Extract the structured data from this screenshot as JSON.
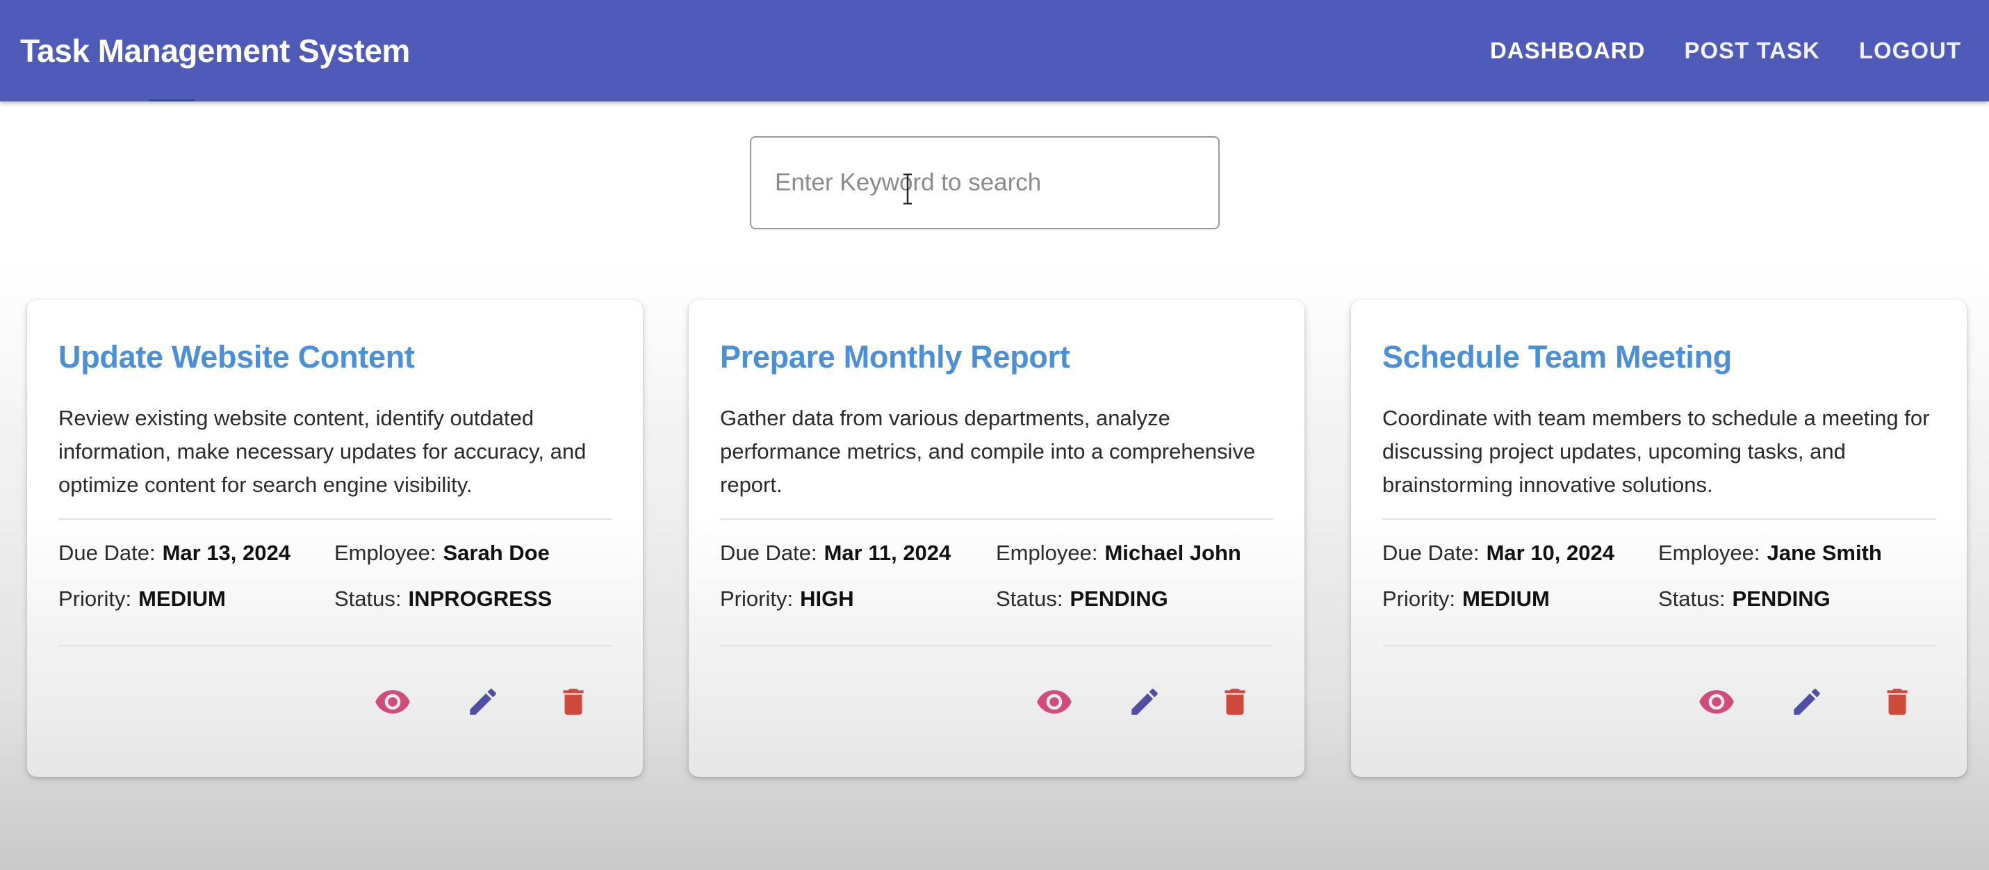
{
  "header": {
    "title": "Task Management System",
    "nav": [
      {
        "label": "DASHBOARD"
      },
      {
        "label": "POST TASK"
      },
      {
        "label": "LOGOUT"
      }
    ]
  },
  "search": {
    "placeholder": "Enter Keyword to search",
    "value": ""
  },
  "labels": {
    "due_date": "Due Date:",
    "employee": "Employee:",
    "priority": "Priority:",
    "status": "Status:"
  },
  "tasks": [
    {
      "title": "Update Website Content",
      "description": "Review existing website content, identify outdated information, make necessary updates for accuracy, and optimize content for search engine visibility.",
      "due_date": "Mar 13, 2024",
      "employee": "Sarah Doe",
      "priority": "MEDIUM",
      "status": "INPROGRESS"
    },
    {
      "title": "Prepare Monthly Report",
      "description": "Gather data from various departments, analyze performance metrics, and compile into a comprehensive report.",
      "due_date": "Mar 11, 2024",
      "employee": "Michael John",
      "priority": "HIGH",
      "status": "PENDING"
    },
    {
      "title": "Schedule Team Meeting",
      "description": "Coordinate with team members to schedule a meeting for discussing project updates, upcoming tasks, and brainstorming innovative solutions.",
      "due_date": "Mar 10, 2024",
      "employee": "Jane Smith",
      "priority": "MEDIUM",
      "status": "PENDING"
    }
  ],
  "colors": {
    "header_bg": "#4f5bb9",
    "title_blue": "#4a90d9",
    "view_icon": "#d14b7c",
    "edit_icon": "#4f4fa6",
    "delete_icon": "#d04a3c"
  },
  "icons": {
    "view": "eye-icon",
    "edit": "pencil-icon",
    "delete": "trash-icon"
  }
}
